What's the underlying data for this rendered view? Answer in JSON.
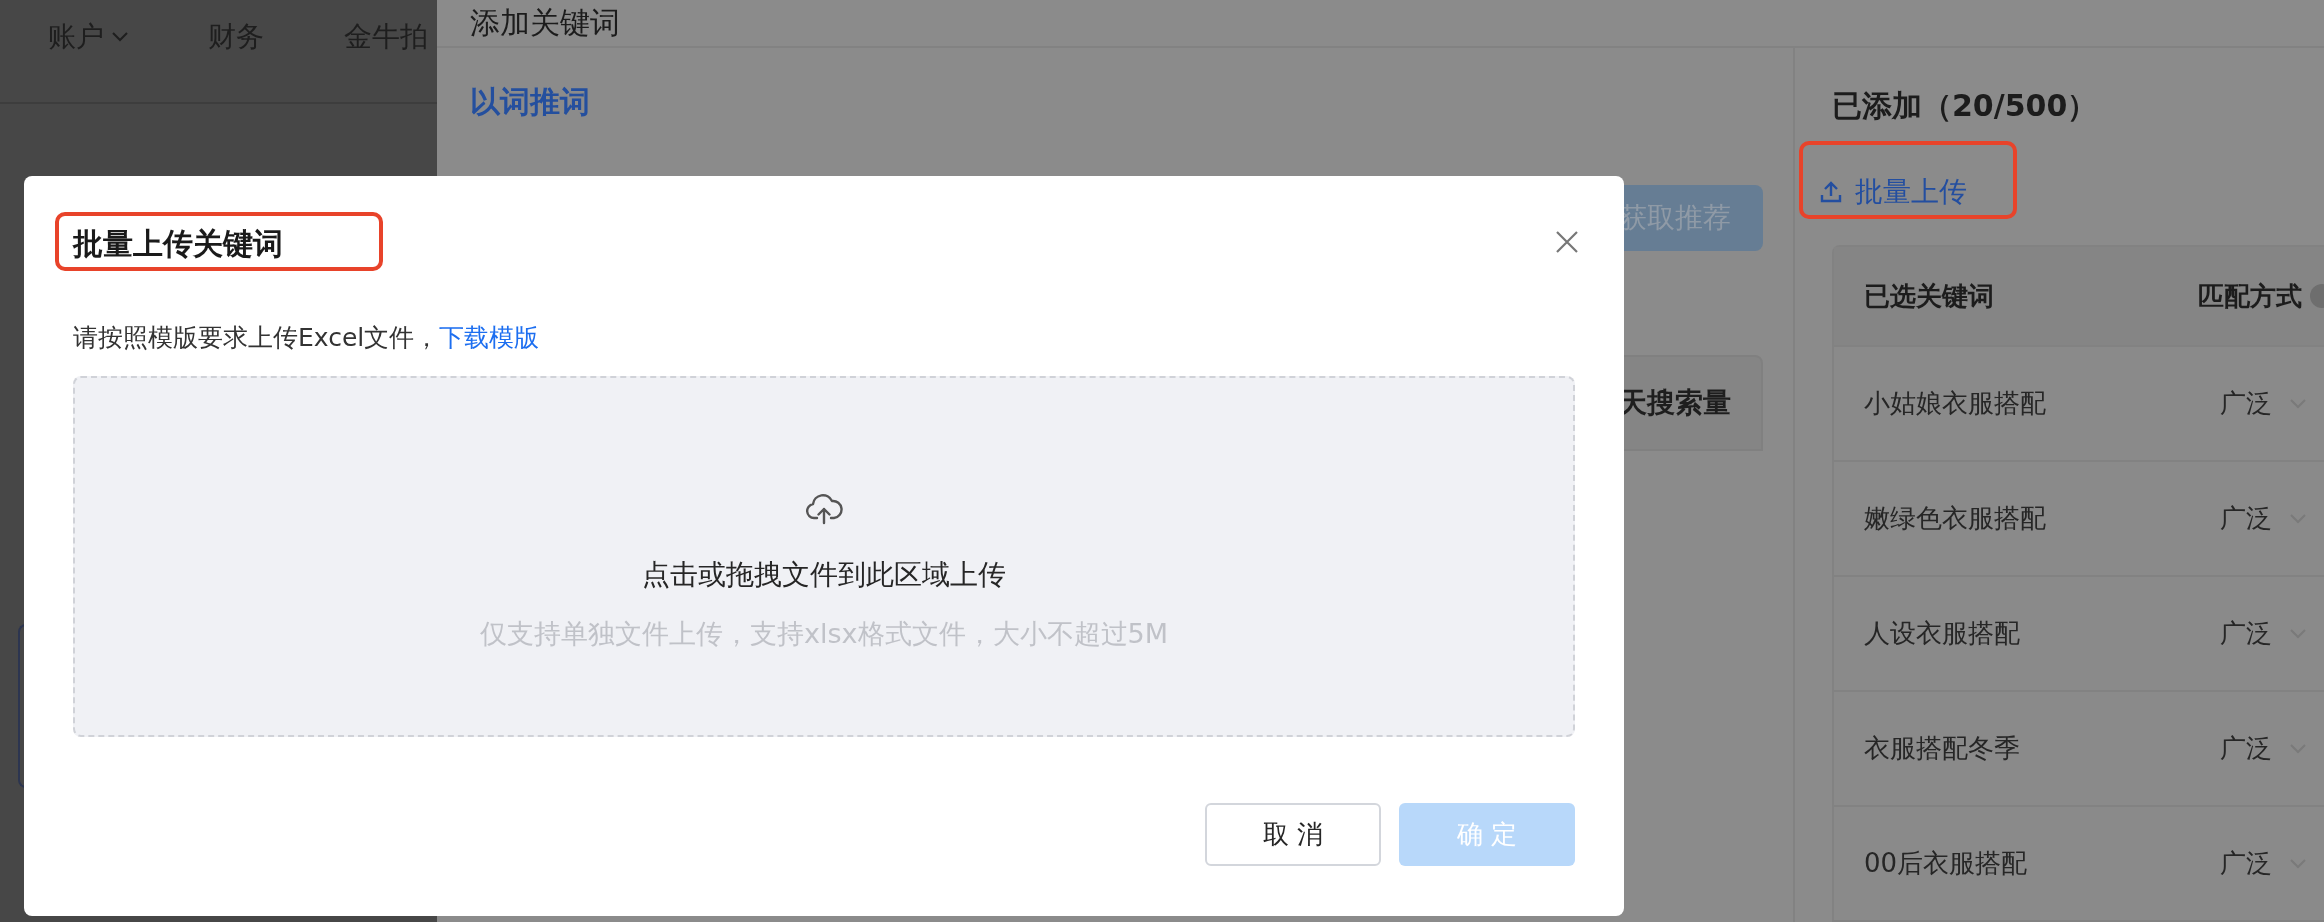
{
  "page": {
    "nav": [
      {
        "label": "账户",
        "dropdown": true
      },
      {
        "label": "财务",
        "dropdown": false
      },
      {
        "label": "金牛拍",
        "dropdown": false
      }
    ]
  },
  "drawer": {
    "title": "添加关键词",
    "recommend": {
      "section_title": "以词推词",
      "button": {
        "label": "获取推荐",
        "disabled": true
      },
      "table_header": "天搜索量"
    },
    "added": {
      "title": "已添加（20/500）",
      "upload_link": {
        "label": "批量上传",
        "annotated": true
      },
      "columns": [
        "已选关键词",
        "匹配方式"
      ],
      "rows": [
        {
          "keyword": "小姑娘衣服搭配",
          "match": "广泛"
        },
        {
          "keyword": "嫩绿色衣服搭配",
          "match": "广泛"
        },
        {
          "keyword": "人设衣服搭配",
          "match": "广泛"
        },
        {
          "keyword": "衣服搭配冬季",
          "match": "广泛"
        },
        {
          "keyword": "00后衣服搭配",
          "match": "广泛"
        }
      ]
    }
  },
  "modal": {
    "title": "批量上传关键词",
    "title_annotated": true,
    "instruction": "请按照模版要求上传Excel文件，",
    "template_link": "下载模版",
    "dropzone": {
      "text": "点击或拖拽文件到此区域上传",
      "hint": "仅支持单独文件上传，支持xlsx格式文件，大小不超过5M"
    },
    "buttons": [
      {
        "label": "取 消",
        "kind": "default",
        "disabled": false
      },
      {
        "label": "确 定",
        "kind": "primary",
        "disabled": true
      }
    ]
  }
}
